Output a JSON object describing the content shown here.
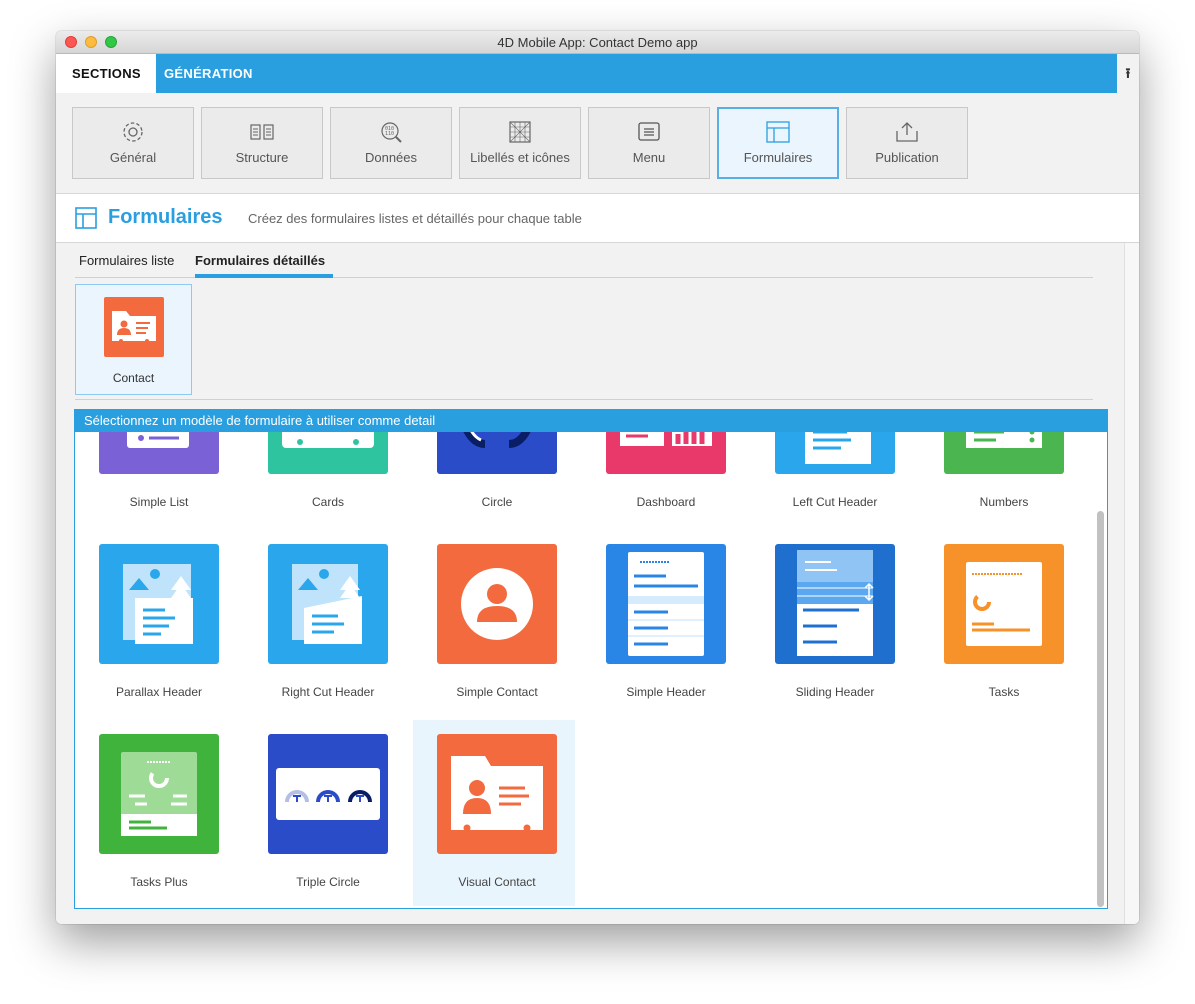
{
  "window": {
    "title": "4D Mobile App: Contact Demo app"
  },
  "tabs": {
    "sections": "SECTIONS",
    "generation": "GÉNÉRATION",
    "export_icon": "upload-icon"
  },
  "toolbar": {
    "items": [
      {
        "label": "Général",
        "icon": "gear-icon"
      },
      {
        "label": "Structure",
        "icon": "structure-icon"
      },
      {
        "label": "Données",
        "icon": "data-icon"
      },
      {
        "label": "Libellés et icônes",
        "icon": "labels-icon"
      },
      {
        "label": "Menu",
        "icon": "menu-icon"
      },
      {
        "label": "Formulaires",
        "icon": "forms-icon",
        "active": true
      },
      {
        "label": "Publication",
        "icon": "publish-icon"
      }
    ]
  },
  "header": {
    "title": "Formulaires",
    "subtitle": "Créez des formulaires listes et détaillés pour chaque table"
  },
  "subtabs": {
    "list": "Formulaires liste",
    "detail": "Formulaires détaillés"
  },
  "tables": [
    {
      "label": "Contact"
    }
  ],
  "picker": {
    "heading": "Sélectionnez un modèle de formulaire à utiliser comme detail",
    "templates": [
      {
        "name": "Simple List",
        "color": "#7a62d6"
      },
      {
        "name": "Cards",
        "color": "#2ec4a0"
      },
      {
        "name": "Circle",
        "color": "#2a4cc9"
      },
      {
        "name": "Dashboard",
        "color": "#e8396a"
      },
      {
        "name": "Left Cut Header",
        "color": "#2aa6ec"
      },
      {
        "name": "Numbers",
        "color": "#4bb54f"
      },
      {
        "name": "Parallax Header",
        "color": "#2aa6ec"
      },
      {
        "name": "Right Cut Header",
        "color": "#2aa6ec"
      },
      {
        "name": "Simple Contact",
        "color": "#f26a3d"
      },
      {
        "name": "Simple Header",
        "color": "#2a86e6"
      },
      {
        "name": "Sliding Header",
        "color": "#1f6fcf"
      },
      {
        "name": "Tasks",
        "color": "#f7912a"
      },
      {
        "name": "Tasks Plus",
        "color": "#3fb33c"
      },
      {
        "name": "Triple Circle",
        "color": "#2a4cc9"
      },
      {
        "name": "Visual Contact",
        "color": "#f26a3d",
        "selected": true
      }
    ]
  }
}
